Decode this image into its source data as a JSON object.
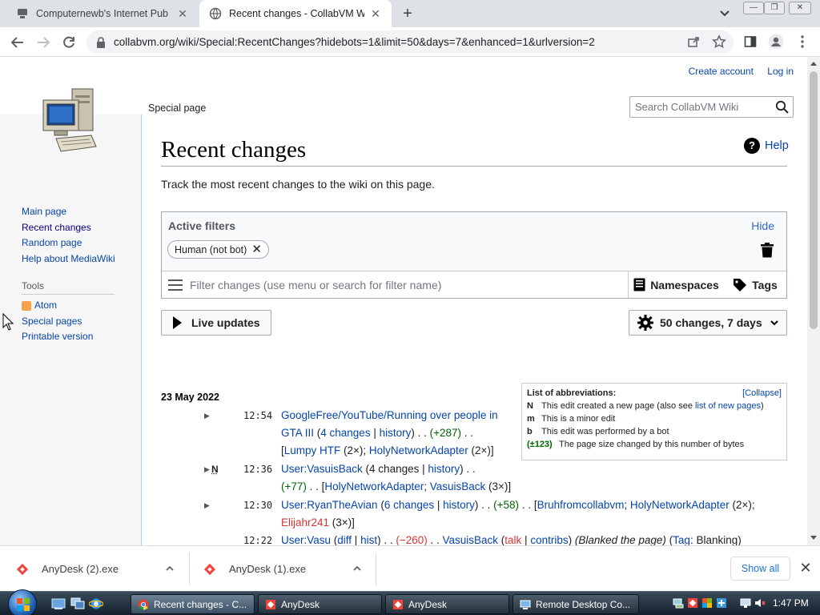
{
  "browser": {
    "tabs": [
      {
        "title": "Computernewb's Internet Pub Hu",
        "active": false
      },
      {
        "title": "Recent changes - CollabVM Wiki",
        "active": true
      }
    ],
    "url": "collabvm.org/wiki/Special:RecentChanges?hidebots=1&limit=50&days=7&enhanced=1&urlversion=2"
  },
  "wiki": {
    "personal": {
      "create_account": "Create account",
      "log_in": "Log in"
    },
    "special_tab": "Special page",
    "search_placeholder": "Search CollabVM Wiki",
    "navigation": [
      "Main page",
      "Recent changes",
      "Random page",
      "Help about MediaWiki"
    ],
    "tools_heading": "Tools",
    "tools": [
      "Atom",
      "Special pages",
      "Printable version"
    ],
    "title": "Recent changes",
    "help": "Help",
    "intro": "Track the most recent changes to the wiki on this page.",
    "filters": {
      "active_label": "Active filters",
      "hide": "Hide",
      "chip": "Human (not bot)",
      "input_placeholder": "Filter changes (use menu or search for filter name)",
      "namespaces": "Namespaces",
      "tags": "Tags"
    },
    "live_updates": "Live updates",
    "limit_button": "50 changes, 7 days",
    "legend": {
      "title": "List of abbreviations:",
      "collapse": "[Collapse]",
      "rows": [
        {
          "key": "N",
          "pre": "This edit created a new page (also see ",
          "link": "list of new pages",
          "post": ")"
        },
        {
          "key": "m",
          "pre": "This is a minor edit",
          "link": "",
          "post": ""
        },
        {
          "key": "b",
          "pre": "This edit was performed by a bot",
          "link": "",
          "post": ""
        },
        {
          "key": "(±123)",
          "pre": "The page size changed by this number of bytes",
          "link": "",
          "post": ""
        }
      ]
    },
    "date": "23 May 2022",
    "changes": [
      {
        "time": "12:54",
        "flag": "",
        "l1": {
          "page": "GoogleFree/YouTube/Running over people in"
        },
        "l2": {
          "page2": "GTA III",
          "open": " (",
          "count": "4 changes",
          "sep": " | ",
          "hist": "history",
          "close": ") . . ",
          "size": "(+287)",
          "tail": " . ."
        },
        "l3": {
          "open": "[",
          "u1": "Lumpy HTF",
          "u1c": " (2×); ",
          "u2": "HolyNetworkAdapter",
          "u2c": " (2×)]"
        }
      },
      {
        "time": "12:36",
        "flag": "N",
        "l1": {
          "page": "User:VasuisBack",
          "open": " (",
          "count": "4 changes",
          "sep": " | ",
          "hist": "history",
          "close": ") . ."
        },
        "l2": {
          "size": "(+77)",
          "mid": " . . [",
          "u1": "HolyNetworkAdapter",
          "sep": "; ",
          "u2": "VasuisBack",
          "end": " (3×)]"
        }
      },
      {
        "time": "12:30",
        "flag": "",
        "l1": {
          "page": "User:RyanTheAvian",
          "open": " (",
          "count": "6 changes",
          "sep": " | ",
          "hist": "history",
          "close": ") . . ",
          "size": "(+58)",
          "mid": " . . [",
          "u1": "Bruhfromcollabvm",
          "sep2": "; ",
          "u2": "HolyNetworkAdapter",
          "u2c": " (2×);"
        },
        "l2": {
          "u3": "Elijahr241",
          "end": " (3×)]"
        }
      },
      {
        "time": "12:22",
        "flag": "",
        "l1": {
          "page": "User:Vasu",
          "open": " (",
          "diff": "diff",
          "sep": " | ",
          "hist": "hist",
          "close": ") . . ",
          "size": "(−260)",
          "mid": " . . ",
          "user": "VasuisBack",
          "talkopen": " (",
          "talk": "talk",
          "sep2": " | ",
          "contribs": "contribs",
          "talkclose": ") ",
          "summary": "(Blanked the page)",
          "tagopen": " (",
          "tag": "Tag",
          "tagrest": ": Blanking)"
        }
      }
    ]
  },
  "downloads": {
    "items": [
      "AnyDesk (2).exe",
      "AnyDesk (1).exe"
    ],
    "show_all": "Show all"
  },
  "taskbar": {
    "tasks": [
      "Recent changes - C...",
      "AnyDesk",
      "AnyDesk",
      "Remote Desktop Co..."
    ],
    "clock": "1:47 PM"
  }
}
